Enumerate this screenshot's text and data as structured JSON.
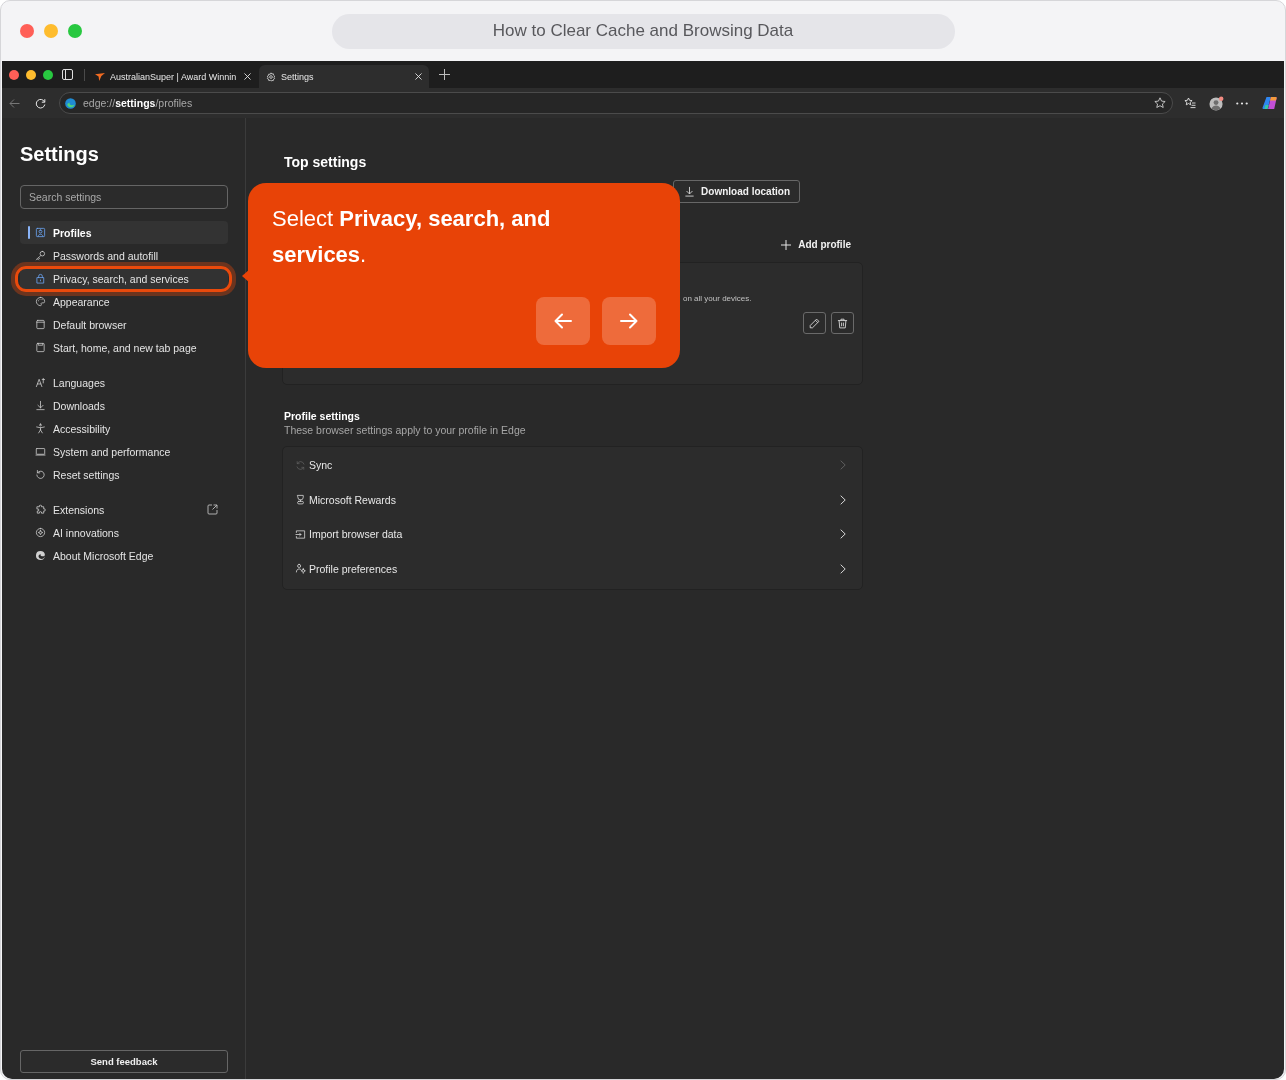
{
  "guide": {
    "title": "How to Clear Cache and Browsing Data"
  },
  "browser": {
    "tabs": [
      {
        "title": "AustralianSuper | Award Winnin",
        "selected": false
      },
      {
        "title": "Settings",
        "selected": true
      }
    ],
    "address": "edge://**settings**/profiles"
  },
  "sidebar": {
    "title": "Settings",
    "search": {
      "placeholder": "Search settings"
    },
    "groups": [
      {
        "items": [
          {
            "label": "Profiles",
            "selected": true,
            "highlighted": false,
            "external_link": false
          },
          {
            "label": "Passwords and autofill",
            "selected": false,
            "highlighted": false,
            "external_link": false
          },
          {
            "label": "Privacy, search, and services",
            "selected": false,
            "highlighted": true,
            "external_link": false
          },
          {
            "label": "Appearance",
            "selected": false,
            "highlighted": false,
            "external_link": false
          },
          {
            "label": "Default browser",
            "selected": false,
            "highlighted": false,
            "external_link": false
          },
          {
            "label": "Start, home, and new tab page",
            "selected": false,
            "highlighted": false,
            "external_link": false
          }
        ]
      },
      {
        "items": [
          {
            "label": "Languages",
            "selected": false,
            "highlighted": false,
            "external_link": false
          },
          {
            "label": "Downloads",
            "selected": false,
            "highlighted": false,
            "external_link": false
          },
          {
            "label": "Accessibility",
            "selected": false,
            "highlighted": false,
            "external_link": false
          },
          {
            "label": "System and performance",
            "selected": false,
            "highlighted": false,
            "external_link": false
          },
          {
            "label": "Reset settings",
            "selected": false,
            "highlighted": false,
            "external_link": false
          }
        ]
      },
      {
        "items": [
          {
            "label": "Extensions",
            "selected": false,
            "highlighted": false,
            "external_link": true
          },
          {
            "label": "AI innovations",
            "selected": false,
            "highlighted": false,
            "external_link": false
          },
          {
            "label": "About Microsoft Edge",
            "selected": false,
            "highlighted": false,
            "external_link": false
          }
        ]
      }
    ],
    "feedback": "Send feedback"
  },
  "top_settings": {
    "title": "Top settings",
    "buttons": [
      {
        "label": "Download location"
      }
    ]
  },
  "profiles": {
    "add_label": "Add profile",
    "note": "on all your devices."
  },
  "profile_settings": {
    "title": "Profile settings",
    "subtitle": "These browser settings apply to your profile in Edge",
    "rows": [
      {
        "label": "Sync",
        "disabled": true
      },
      {
        "label": "Microsoft Rewards",
        "disabled": false
      },
      {
        "label": "Import browser data",
        "disabled": false
      },
      {
        "label": "Profile preferences",
        "disabled": false
      }
    ]
  },
  "tooltip": {
    "text": "Select **Privacy, search, and services**."
  }
}
